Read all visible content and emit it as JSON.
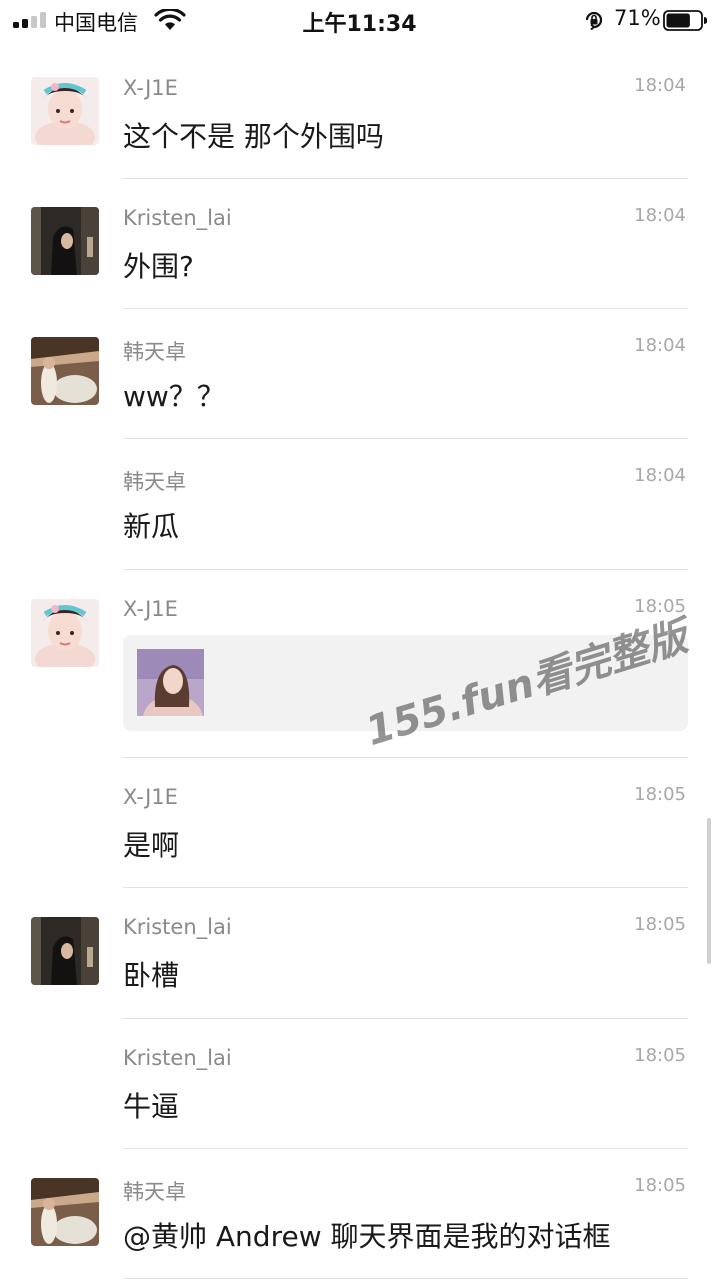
{
  "status_bar": {
    "carrier": "中国电信",
    "time": "上午11:34",
    "battery_percent": "71%",
    "signal_bars_active": 2,
    "battery_level": 0.71,
    "icons": [
      "signal-icon",
      "wifi-icon",
      "orientation-lock-icon",
      "battery-icon"
    ]
  },
  "messages": [
    {
      "sender": "X-J1E",
      "time": "18:04",
      "text": "这个不是 那个外围吗",
      "avatar": "avatar-x-j1e"
    },
    {
      "sender": "Kristen_lai",
      "time": "18:04",
      "text": "外围?",
      "avatar": "avatar-kristen-lai"
    },
    {
      "sender": "韩天卓",
      "time": "18:04",
      "text": "ww？？",
      "avatar": "avatar-han-tianzhuo"
    },
    {
      "sender": "韩天卓",
      "time": "18:04",
      "text": "新瓜"
    },
    {
      "sender": "X-J1E",
      "time": "18:05",
      "type": "image",
      "avatar": "avatar-x-j1e"
    },
    {
      "sender": "X-J1E",
      "time": "18:05",
      "text": "是啊"
    },
    {
      "sender": "Kristen_lai",
      "time": "18:05",
      "text": "卧槽",
      "avatar": "avatar-kristen-lai"
    },
    {
      "sender": "Kristen_lai",
      "time": "18:05",
      "text": "牛逼"
    },
    {
      "sender": "韩天卓",
      "time": "18:05",
      "text": "@黄帅 Andrew 聊天界面是我的对话框",
      "avatar": "avatar-han-tianzhuo"
    }
  ],
  "watermark": "155.fun看完整版"
}
